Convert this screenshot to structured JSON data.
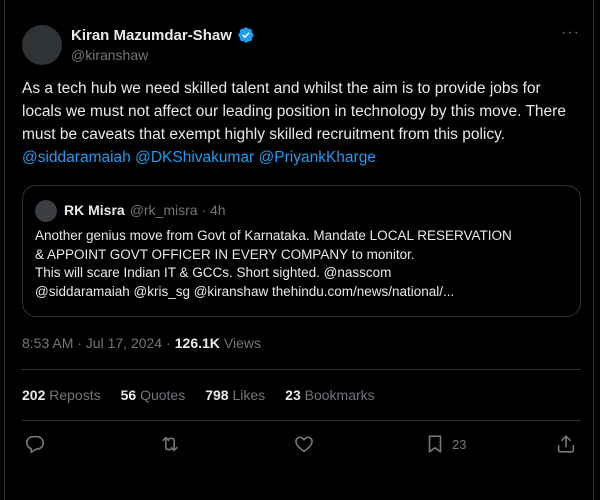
{
  "author": {
    "display_name": "Kiran Mazumdar-Shaw",
    "handle": "@kiranshaw"
  },
  "more_icon": "···",
  "tweet": {
    "text": "As a tech hub we need skilled talent and whilst the aim is to provide jobs for locals we must not affect our leading position in technology by this move.  There must be caveats that exempt highly skilled recruitment from this policy. ",
    "mentions": [
      "@siddaramaiah",
      "@DKShivakumar",
      "@PriyankKharge"
    ]
  },
  "quote": {
    "name": "RK Misra",
    "meta": "@rk_misra · 4h",
    "lines": [
      "Another genius move from Govt of Karnataka. Mandate LOCAL RESERVATION",
      "& APPOINT GOVT OFFICER IN EVERY COMPANY to monitor.",
      "This will scare Indian IT & GCCs. Short sighted. @nasscom",
      "@siddaramaiah @kris_sg @kiranshaw  thehindu.com/news/national/..."
    ]
  },
  "meta": {
    "timestamp": "8:53 AM · Jul 17, 2024",
    "separator": "·",
    "views_count": "126.1K",
    "views_label": "Views"
  },
  "stats": [
    {
      "count": "202",
      "label": "Reposts"
    },
    {
      "count": "56",
      "label": "Quotes"
    },
    {
      "count": "798",
      "label": "Likes"
    },
    {
      "count": "23",
      "label": "Bookmarks"
    }
  ],
  "actions": {
    "bookmark_count": "23"
  },
  "colors": {
    "background": "#000000",
    "text": "#e7e9ea",
    "secondary": "#71767b",
    "accent": "#1d9bf0",
    "border": "#2f3336"
  }
}
